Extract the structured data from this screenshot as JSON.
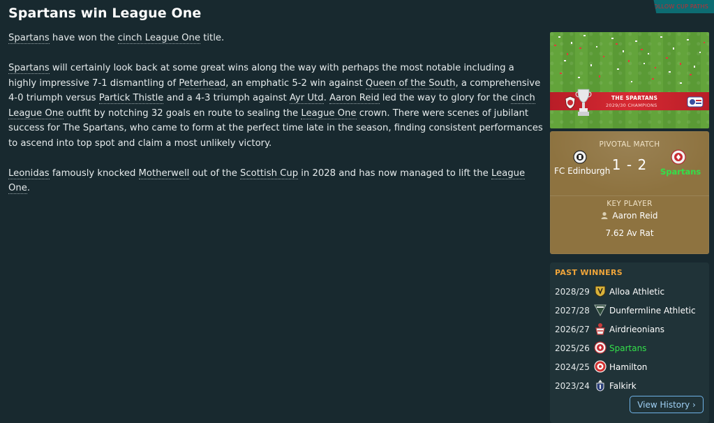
{
  "corner_tag": "FOLLOW CUP PATHS",
  "headline": "Spartans win League One",
  "article": {
    "p1": [
      "Spartans",
      " have won the ",
      "cinch League One",
      " title."
    ],
    "p2": [
      "Spartans",
      " will certainly look back at some great wins along the way with perhaps the most notable including a highly impressive 7-1 dismantling of ",
      "Peterhead",
      ", an emphatic 5-2 win against ",
      "Queen of the South",
      ", a comprehensive 4-0 triumph versus ",
      "Partick Thistle",
      " and a 4-3 triumph against ",
      "Ayr Utd",
      ". ",
      "Aaron Reid",
      " led the way to glory for the ",
      "cinch League One",
      " outfit by notching 32 goals en route to sealing the ",
      "League One",
      " crown. There were scenes of jubilant success for The Spartans, who came to form at the perfect time late in the season, finding consistent performances to ascend into top spot and claim a most unlikely victory."
    ],
    "p3": [
      "Leonidas",
      " famously knocked ",
      "Motherwell",
      " out of the ",
      "Scottish Cup",
      " in 2028 and has now managed to lift the ",
      "League One",
      "."
    ]
  },
  "banner": {
    "title": "THE SPARTANS",
    "subtitle": "2029/30 CHAMPIONS"
  },
  "pivotal_match": {
    "label": "PIVOTAL MATCH",
    "home": "FC Edinburgh",
    "away": "Spartans",
    "score": "1 - 2"
  },
  "key_player": {
    "label": "KEY PLAYER",
    "name": "Aaron Reid",
    "rating": "7.62 Av Rat"
  },
  "past_winners": {
    "title": "PAST WINNERS",
    "rows": [
      {
        "season": "2028/29",
        "team": "Alloa Athletic",
        "crest": "alloa-crest",
        "color": "#d9b23a"
      },
      {
        "season": "2027/28",
        "team": "Dunfermline Athletic",
        "crest": "dunfermline-crest",
        "color": "#2c4a3a"
      },
      {
        "season": "2026/27",
        "team": "Airdrieonians",
        "crest": "airdrieonians-crest",
        "color": "#c93a3a"
      },
      {
        "season": "2025/26",
        "team": "Spartans",
        "crest": "spartans-crest",
        "color": "#c93a3a"
      },
      {
        "season": "2024/25",
        "team": "Hamilton",
        "crest": "hamilton-crest",
        "color": "#d03030"
      },
      {
        "season": "2023/24",
        "team": "Falkirk",
        "crest": "falkirk-crest",
        "color": "#2a3f7a"
      }
    ],
    "button": "View History ›"
  },
  "colors": {
    "background": "#18292f",
    "card_gold": "#8e7340",
    "winners_title": "#f0a53a",
    "highlight_green": "#33e04a",
    "button_border": "#6fb2e6"
  }
}
